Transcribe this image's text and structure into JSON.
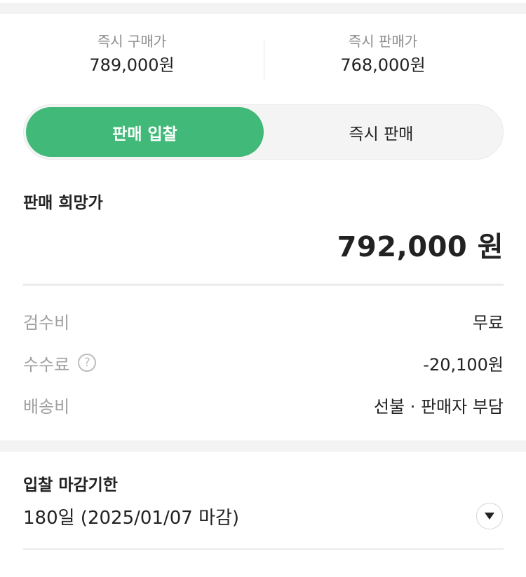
{
  "summary": {
    "buy_now_label": "즉시 구매가",
    "buy_now_price": "789,000원",
    "sell_now_label": "즉시 판매가",
    "sell_now_price": "768,000원"
  },
  "toggle": {
    "active_label": "판매 입찰",
    "inactive_label": "즉시 판매"
  },
  "wish": {
    "title": "판매 희망가",
    "price": "792,000 원"
  },
  "fees": [
    {
      "label": "검수비",
      "value": "무료"
    },
    {
      "label": "수수료",
      "value": "-20,100원",
      "help": "?"
    },
    {
      "label": "배송비",
      "value": "선불 · 판매자 부담"
    }
  ],
  "deadline": {
    "title": "입찰 마감기한",
    "value": "180일 (2025/01/07 마감)",
    "icon": "chevron-down-icon"
  },
  "colors": {
    "accent": "#41b979",
    "muted": "#a0a0a0",
    "text": "#222222"
  }
}
